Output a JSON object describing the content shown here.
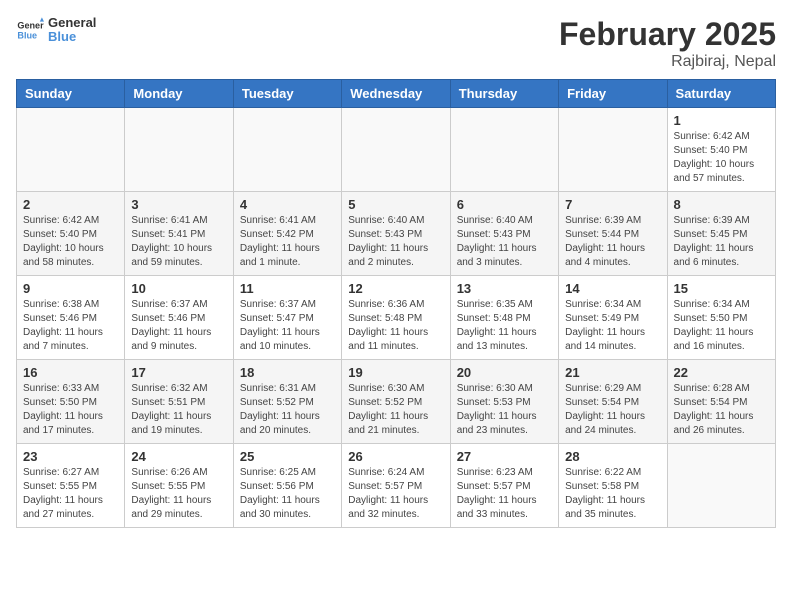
{
  "logo": {
    "text_general": "General",
    "text_blue": "Blue"
  },
  "header": {
    "month": "February 2025",
    "location": "Rajbiraj, Nepal"
  },
  "weekdays": [
    "Sunday",
    "Monday",
    "Tuesday",
    "Wednesday",
    "Thursday",
    "Friday",
    "Saturday"
  ],
  "weeks": [
    [
      {
        "day": "",
        "info": ""
      },
      {
        "day": "",
        "info": ""
      },
      {
        "day": "",
        "info": ""
      },
      {
        "day": "",
        "info": ""
      },
      {
        "day": "",
        "info": ""
      },
      {
        "day": "",
        "info": ""
      },
      {
        "day": "1",
        "info": "Sunrise: 6:42 AM\nSunset: 5:40 PM\nDaylight: 10 hours and 57 minutes."
      }
    ],
    [
      {
        "day": "2",
        "info": "Sunrise: 6:42 AM\nSunset: 5:40 PM\nDaylight: 10 hours and 58 minutes."
      },
      {
        "day": "3",
        "info": "Sunrise: 6:41 AM\nSunset: 5:41 PM\nDaylight: 10 hours and 59 minutes."
      },
      {
        "day": "4",
        "info": "Sunrise: 6:41 AM\nSunset: 5:42 PM\nDaylight: 11 hours and 1 minute."
      },
      {
        "day": "5",
        "info": "Sunrise: 6:40 AM\nSunset: 5:43 PM\nDaylight: 11 hours and 2 minutes."
      },
      {
        "day": "6",
        "info": "Sunrise: 6:40 AM\nSunset: 5:43 PM\nDaylight: 11 hours and 3 minutes."
      },
      {
        "day": "7",
        "info": "Sunrise: 6:39 AM\nSunset: 5:44 PM\nDaylight: 11 hours and 4 minutes."
      },
      {
        "day": "8",
        "info": "Sunrise: 6:39 AM\nSunset: 5:45 PM\nDaylight: 11 hours and 6 minutes."
      }
    ],
    [
      {
        "day": "9",
        "info": "Sunrise: 6:38 AM\nSunset: 5:46 PM\nDaylight: 11 hours and 7 minutes."
      },
      {
        "day": "10",
        "info": "Sunrise: 6:37 AM\nSunset: 5:46 PM\nDaylight: 11 hours and 9 minutes."
      },
      {
        "day": "11",
        "info": "Sunrise: 6:37 AM\nSunset: 5:47 PM\nDaylight: 11 hours and 10 minutes."
      },
      {
        "day": "12",
        "info": "Sunrise: 6:36 AM\nSunset: 5:48 PM\nDaylight: 11 hours and 11 minutes."
      },
      {
        "day": "13",
        "info": "Sunrise: 6:35 AM\nSunset: 5:48 PM\nDaylight: 11 hours and 13 minutes."
      },
      {
        "day": "14",
        "info": "Sunrise: 6:34 AM\nSunset: 5:49 PM\nDaylight: 11 hours and 14 minutes."
      },
      {
        "day": "15",
        "info": "Sunrise: 6:34 AM\nSunset: 5:50 PM\nDaylight: 11 hours and 16 minutes."
      }
    ],
    [
      {
        "day": "16",
        "info": "Sunrise: 6:33 AM\nSunset: 5:50 PM\nDaylight: 11 hours and 17 minutes."
      },
      {
        "day": "17",
        "info": "Sunrise: 6:32 AM\nSunset: 5:51 PM\nDaylight: 11 hours and 19 minutes."
      },
      {
        "day": "18",
        "info": "Sunrise: 6:31 AM\nSunset: 5:52 PM\nDaylight: 11 hours and 20 minutes."
      },
      {
        "day": "19",
        "info": "Sunrise: 6:30 AM\nSunset: 5:52 PM\nDaylight: 11 hours and 21 minutes."
      },
      {
        "day": "20",
        "info": "Sunrise: 6:30 AM\nSunset: 5:53 PM\nDaylight: 11 hours and 23 minutes."
      },
      {
        "day": "21",
        "info": "Sunrise: 6:29 AM\nSunset: 5:54 PM\nDaylight: 11 hours and 24 minutes."
      },
      {
        "day": "22",
        "info": "Sunrise: 6:28 AM\nSunset: 5:54 PM\nDaylight: 11 hours and 26 minutes."
      }
    ],
    [
      {
        "day": "23",
        "info": "Sunrise: 6:27 AM\nSunset: 5:55 PM\nDaylight: 11 hours and 27 minutes."
      },
      {
        "day": "24",
        "info": "Sunrise: 6:26 AM\nSunset: 5:55 PM\nDaylight: 11 hours and 29 minutes."
      },
      {
        "day": "25",
        "info": "Sunrise: 6:25 AM\nSunset: 5:56 PM\nDaylight: 11 hours and 30 minutes."
      },
      {
        "day": "26",
        "info": "Sunrise: 6:24 AM\nSunset: 5:57 PM\nDaylight: 11 hours and 32 minutes."
      },
      {
        "day": "27",
        "info": "Sunrise: 6:23 AM\nSunset: 5:57 PM\nDaylight: 11 hours and 33 minutes."
      },
      {
        "day": "28",
        "info": "Sunrise: 6:22 AM\nSunset: 5:58 PM\nDaylight: 11 hours and 35 minutes."
      },
      {
        "day": "",
        "info": ""
      }
    ]
  ]
}
